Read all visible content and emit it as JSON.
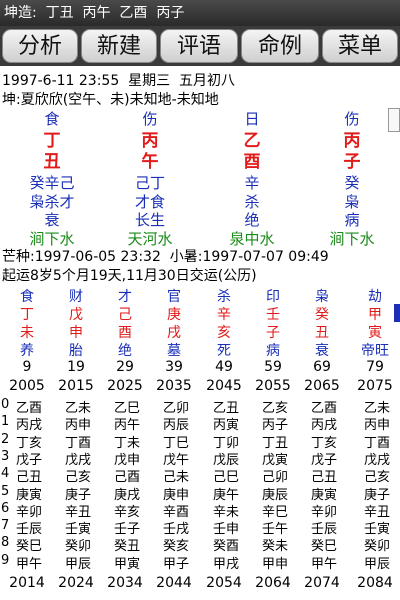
{
  "header": {
    "title": "坤造:  丁丑  丙午  乙酉  丙子"
  },
  "tabs": [
    "分析",
    "新建",
    "评语",
    "命例",
    "菜单"
  ],
  "info": {
    "line1": "1997-6-11 23:55  星期三  五月初八",
    "line2": "坤:夏欣欣(空午、未)未知地-未知地"
  },
  "pillars": [
    {
      "shishen": "食",
      "stem": "丁",
      "branch": "丑",
      "hidden": "癸辛己",
      "hidden_ss": "枭杀才",
      "state": "衰",
      "nayin": "涧下水"
    },
    {
      "shishen": "伤",
      "stem": "丙",
      "branch": "午",
      "hidden": "己丁",
      "hidden_ss": "才食",
      "state": "长生",
      "nayin": "天河水"
    },
    {
      "shishen": "日",
      "stem": "乙",
      "branch": "酉",
      "hidden": "辛",
      "hidden_ss": "杀",
      "state": "绝",
      "nayin": "泉中水"
    },
    {
      "shishen": "伤",
      "stem": "丙",
      "branch": "子",
      "hidden": "癸",
      "hidden_ss": "枭",
      "state": "病",
      "nayin": "涧下水"
    }
  ],
  "terms": {
    "line1": "芒种:1997-06-05 23:32  小暑:1997-07-07 09:49",
    "line2": "起运8岁5个月19天,11月30日交运(公历)"
  },
  "dayun": [
    {
      "ss": "食",
      "stem": "丁",
      "branch": "未",
      "state": "养",
      "age": "9",
      "year": "2005"
    },
    {
      "ss": "财",
      "stem": "戊",
      "branch": "申",
      "state": "胎",
      "age": "19",
      "year": "2015"
    },
    {
      "ss": "才",
      "stem": "己",
      "branch": "酉",
      "state": "绝",
      "age": "29",
      "year": "2025"
    },
    {
      "ss": "官",
      "stem": "庚",
      "branch": "戌",
      "state": "墓",
      "age": "39",
      "year": "2035"
    },
    {
      "ss": "杀",
      "stem": "辛",
      "branch": "亥",
      "state": "死",
      "age": "49",
      "year": "2045"
    },
    {
      "ss": "印",
      "stem": "壬",
      "branch": "子",
      "state": "病",
      "age": "59",
      "year": "2055"
    },
    {
      "ss": "枭",
      "stem": "癸",
      "branch": "丑",
      "state": "衰",
      "age": "69",
      "year": "2065"
    },
    {
      "ss": "劫",
      "stem": "甲",
      "branch": "寅",
      "state": "帝旺",
      "age": "79",
      "year": "2075"
    }
  ],
  "liunian_prefix": [
    "0",
    "1",
    "2",
    "3",
    "4",
    "5",
    "6",
    "7",
    "8",
    "9"
  ],
  "liunian": [
    [
      "乙酉",
      "丙戌",
      "丁亥",
      "戊子",
      "己丑",
      "庚寅",
      "辛卯",
      "壬辰",
      "癸巳",
      "甲午"
    ],
    [
      "乙未",
      "丙申",
      "丁酉",
      "戊戌",
      "己亥",
      "庚子",
      "辛丑",
      "壬寅",
      "癸卯",
      "甲辰"
    ],
    [
      "乙巳",
      "丙午",
      "丁未",
      "戊申",
      "己酉",
      "庚戌",
      "辛亥",
      "壬子",
      "癸丑",
      "甲寅"
    ],
    [
      "乙卯",
      "丙辰",
      "丁巳",
      "戊午",
      "己未",
      "庚申",
      "辛酉",
      "壬戌",
      "癸亥",
      "甲子"
    ],
    [
      "乙丑",
      "丙寅",
      "丁卯",
      "戊辰",
      "己巳",
      "庚午",
      "辛未",
      "壬申",
      "癸酉",
      "甲戌"
    ],
    [
      "乙亥",
      "丙子",
      "丁丑",
      "戊寅",
      "己卯",
      "庚辰",
      "辛巳",
      "壬午",
      "癸未",
      "甲申"
    ],
    [
      "乙酉",
      "丙戌",
      "丁亥",
      "戊子",
      "己丑",
      "庚寅",
      "辛卯",
      "壬辰",
      "癸巳",
      "甲午"
    ],
    [
      "乙未",
      "丙申",
      "丁酉",
      "戊戌",
      "己亥",
      "庚子",
      "辛丑",
      "壬寅",
      "癸卯",
      "甲辰"
    ]
  ],
  "end_years": [
    "2014",
    "2024",
    "2034",
    "2044",
    "2054",
    "2064",
    "2074",
    "2084"
  ]
}
